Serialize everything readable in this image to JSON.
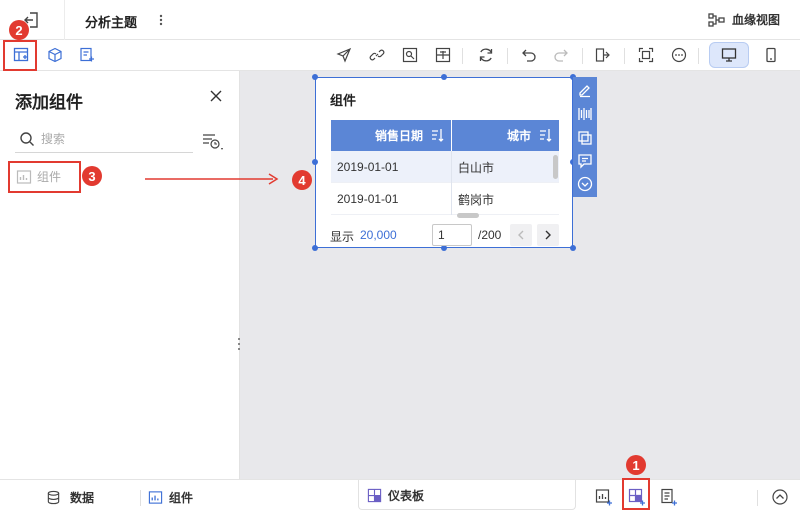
{
  "topbar": {
    "title": "分析主题",
    "lineage_label": "血缘视图"
  },
  "panel": {
    "title": "添加组件",
    "search_placeholder": "搜索",
    "item_label": "组件"
  },
  "widget": {
    "title": "组件",
    "columns": [
      "销售日期",
      "城市"
    ],
    "rows": [
      [
        "2019-01-01",
        "白山市"
      ],
      [
        "2019-01-01",
        "鹤岗市"
      ]
    ],
    "footer": {
      "show_label": "显示",
      "count": "20,000",
      "page": "1",
      "total": "/200"
    }
  },
  "bottombar": {
    "data_label": "数据",
    "components_label": "组件",
    "dashboard_label": "仪表板"
  },
  "annotations": [
    "1",
    "2",
    "3",
    "4"
  ],
  "colors": {
    "accent": "#3d6fd6",
    "header": "#5b86d6",
    "annotation": "#e23a30",
    "device_active": "#dde7fb"
  }
}
